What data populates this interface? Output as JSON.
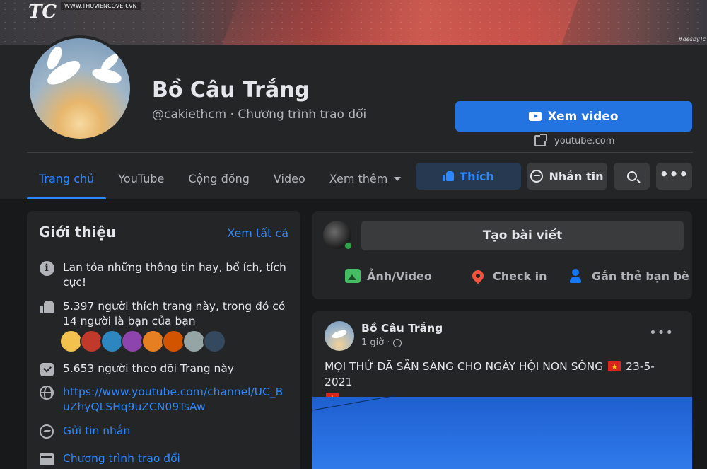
{
  "cover": {
    "url_text": "WWW.THUVIENCOVER.VN",
    "logo_text": "TC",
    "tag_text": "#desbyTc"
  },
  "profile": {
    "name": "Bồ Câu Trắng",
    "handle": "@cakiethcm · Chương trình trao đổi"
  },
  "cta": {
    "label": "Xem video",
    "link_text": "youtube.com",
    "icon": "youtube-icon"
  },
  "tabs": [
    {
      "label": "Trang chủ",
      "active": true
    },
    {
      "label": "YouTube",
      "active": false
    },
    {
      "label": "Cộng đồng",
      "active": false
    },
    {
      "label": "Video",
      "active": false
    },
    {
      "label": "Xem thêm",
      "active": false
    }
  ],
  "actions": {
    "like": "Thích",
    "message": "Nhắn tin",
    "search_icon": "search-icon",
    "more_icon": "more-icon"
  },
  "intro": {
    "title": "Giới thiệu",
    "see_all": "Xem tất cả",
    "description": "Lan tỏa những thông tin hay, bổ ích, tích cực!",
    "likes": "5.397 người thích trang này, trong đó có 14 người là bạn của bạn",
    "followers": "5.653 người theo dõi Trang này",
    "website": "https://www.youtube.com/channel/UC_BuZhyQLSHq9uZCN09TsAw",
    "send_message": "Gửi tin nhắn",
    "category": "Chương trình trao đổi",
    "friend_avatar_colors": [
      "#f2c14e",
      "#c0392b",
      "#2e86c1",
      "#8e44ad",
      "#e67e22",
      "#d35400",
      "#95a5a6",
      "#34495e"
    ]
  },
  "composer": {
    "create_post": "Tạo bài viết",
    "photo_video": "Ảnh/Video",
    "check_in": "Check in",
    "tag_friends": "Gắn thẻ bạn bè"
  },
  "post": {
    "author": "Bồ Câu Trắng",
    "time": "1 giờ ·",
    "text_before_flag": "MỌI THỨ ĐÃ SẴN SÀNG CHO NGÀY HỘI NON SÔNG ",
    "text_after_flag": " 23-5-2021"
  },
  "colors": {
    "accent": "#2d88ff",
    "primary_button": "#2374e1",
    "surface": "#242526",
    "background": "#18191a"
  }
}
